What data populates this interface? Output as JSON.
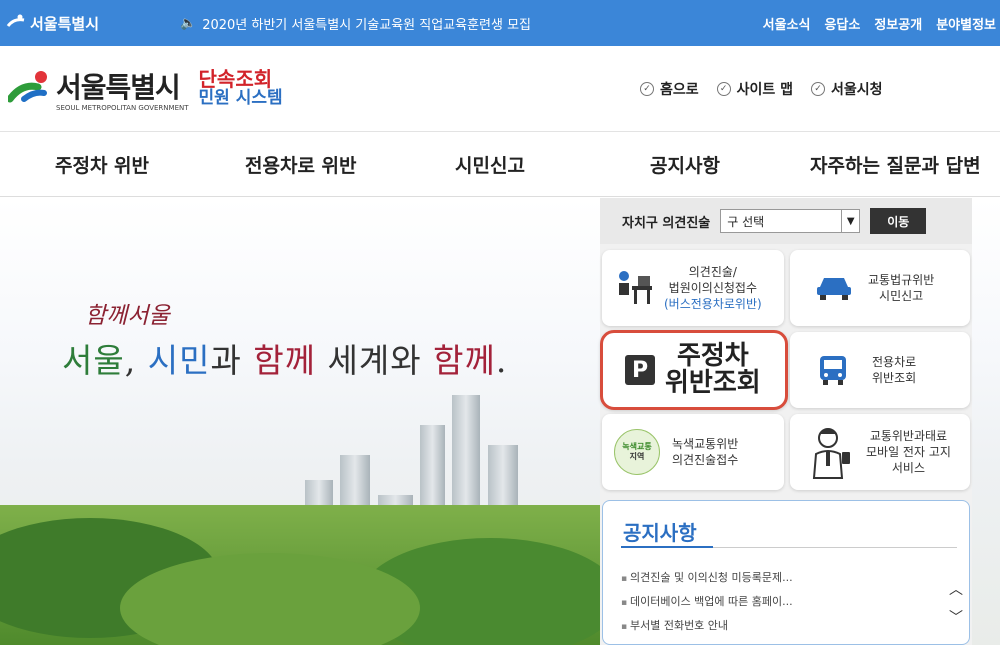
{
  "topbar": {
    "brand": "서울특별시",
    "notice": "2020년 하반기 서울특별시 기술교육원 직업교육훈련생 모집",
    "links": [
      "서울소식",
      "응답소",
      "정보공개",
      "분야별정보"
    ]
  },
  "header": {
    "logo_title": "서울특별시",
    "logo_sub": "SEOUL METROPOLITAN GOVERNMENT",
    "system_title_1": "단속조회",
    "system_title_2": "민원 시스템",
    "links": [
      "홈으로",
      "사이트 맵",
      "서울시청"
    ]
  },
  "nav": [
    "주정차 위반",
    "전용차로 위반",
    "시민신고",
    "공지사항",
    "자주하는 질문과 답변"
  ],
  "hero": {
    "slogan_small": "함께서울",
    "slogan_parts": [
      "서울",
      ", ",
      "시민",
      "과 ",
      "함께",
      " 세계와 ",
      "함께",
      "."
    ]
  },
  "panel": {
    "select_label": "자치구 의견진술",
    "select_value": "구 선택",
    "go_label": "이동",
    "tiles": {
      "opinion": {
        "line1": "의견진술/",
        "line2": "법원이의신청접수",
        "line3": "(버스전용차로위반)"
      },
      "traffic_report": {
        "line1": "교통법규위반",
        "line2": "시민신고"
      },
      "parking": {
        "p": "P",
        "line1": "주정차",
        "line2": "위반조회"
      },
      "lane": {
        "line1": "전용차로",
        "line2": "위반조회"
      },
      "green": {
        "badge_line1": "녹색교통",
        "badge_line2": "지역",
        "line1": "녹색교통위반",
        "line2": "의견진술접수"
      },
      "mobile": {
        "line1": "교통위반과태료",
        "line2": "모바일 전자 고지",
        "line3": "서비스"
      }
    },
    "notice": {
      "title": "공지사항",
      "items": [
        "의견진술 및 이의신청 미등록문제...",
        "데이터베이스 백업에 따른 홈페이...",
        "부서별 전화번호 안내"
      ]
    }
  }
}
